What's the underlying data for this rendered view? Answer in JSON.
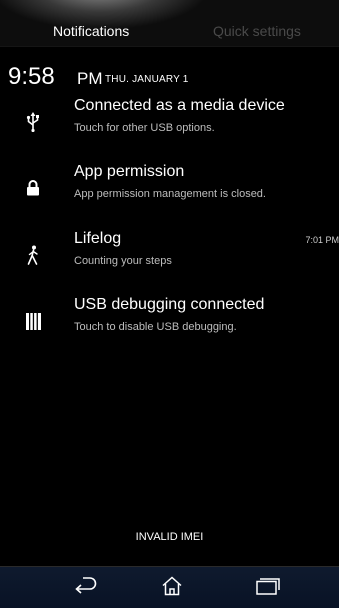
{
  "tabs": {
    "notifications": "Notifications",
    "quick_settings": "Quick settings"
  },
  "clock": {
    "time": "9:58",
    "ampm": "PM",
    "date": "THU. JANUARY 1"
  },
  "notifications": [
    {
      "icon": "usb-icon",
      "title": "Connected as a media device",
      "subtitle": "Touch for other USB options.",
      "time": ""
    },
    {
      "icon": "lock-icon",
      "title": "App permission",
      "subtitle": "App permission management is closed.",
      "time": ""
    },
    {
      "icon": "walking-person-icon",
      "title": "Lifelog",
      "subtitle": "Counting your steps",
      "time": "7:01 PM"
    },
    {
      "icon": "usb-debugging-icon",
      "title": "USB debugging connected",
      "subtitle": "Touch to disable USB debugging.",
      "time": ""
    }
  ],
  "carrier": "INVALID IMEI",
  "nav": {
    "back_icon": "back-icon",
    "home_icon": "home-icon",
    "recents_icon": "recent-apps-icon"
  },
  "colors": {
    "background": "#000000",
    "text_primary": "#ffffff",
    "text_secondary": "#bdbdbd",
    "tab_inactive": "#4a4a4a",
    "navbar": "#0f1a2e"
  }
}
